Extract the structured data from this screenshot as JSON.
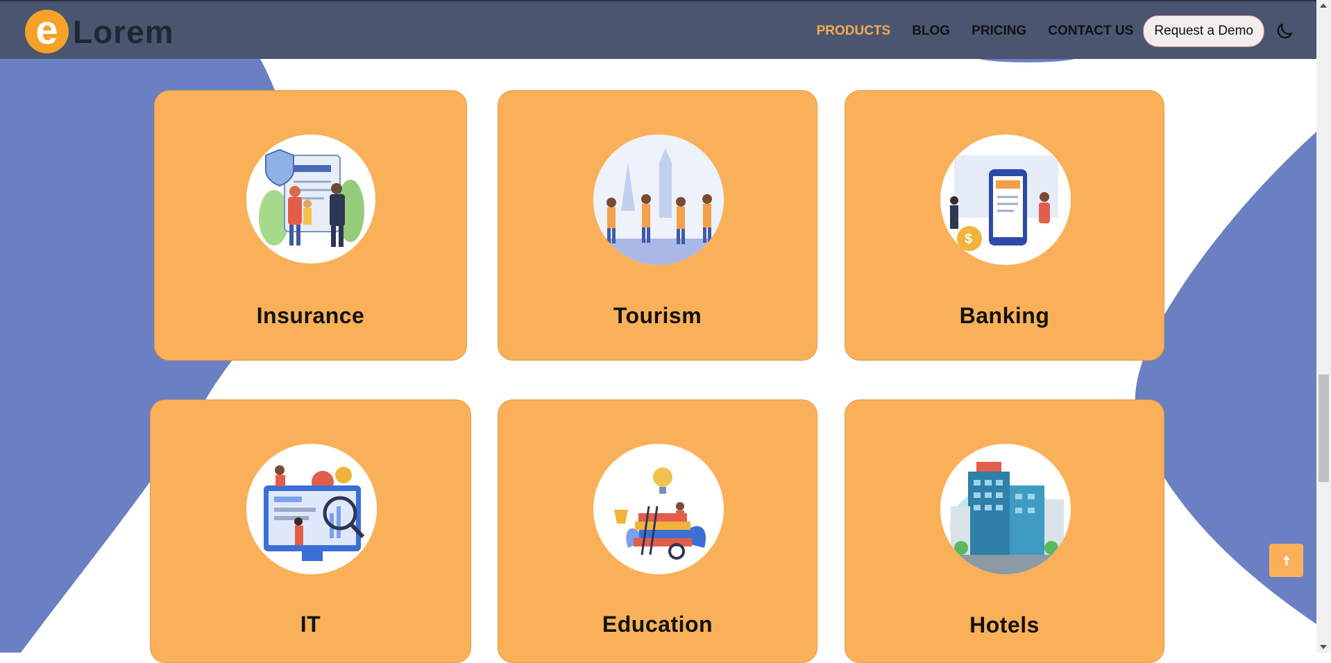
{
  "brand": {
    "logo_letter": "e",
    "name": "Lorem"
  },
  "nav": {
    "links": [
      {
        "label": "PRODUCTS",
        "active": true
      },
      {
        "label": "BLOG",
        "active": false
      },
      {
        "label": "PRICING",
        "active": false
      },
      {
        "label": "CONTACT US",
        "active": false
      }
    ],
    "cta_label": "Request a Demo",
    "theme_icon": "moon-icon"
  },
  "products": [
    {
      "title": "Insurance",
      "icon": "insurance-illustration"
    },
    {
      "title": "Tourism",
      "icon": "tourism-illustration"
    },
    {
      "title": "Banking",
      "icon": "banking-illustration"
    },
    {
      "title": "IT",
      "icon": "it-illustration"
    },
    {
      "title": "Education",
      "icon": "education-illustration"
    },
    {
      "title": "Hotels",
      "icon": "hotels-illustration"
    }
  ],
  "scroll_top_icon": "arrow-up-icon",
  "colors": {
    "navbar": "#4a5670",
    "accent": "#f7a94f",
    "card": "#f9b058",
    "background_blob": "#6b80c2"
  }
}
